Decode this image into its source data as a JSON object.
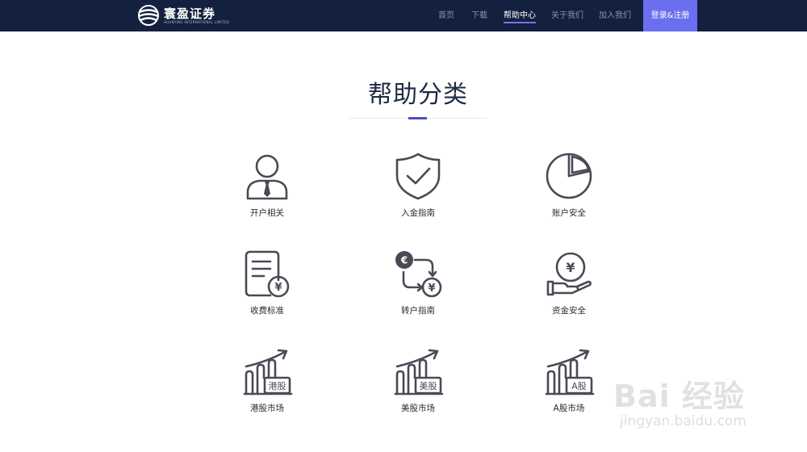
{
  "header": {
    "logo_text": "寰盈证券",
    "logo_subtext": "HUANYING INTERNATIONAL LIMITED",
    "nav": [
      {
        "label": "首页",
        "active": false
      },
      {
        "label": "下载",
        "active": false
      },
      {
        "label": "帮助中心",
        "active": true
      },
      {
        "label": "关于我们",
        "active": false
      },
      {
        "label": "加入我们",
        "active": false
      }
    ],
    "login_label": "登录&注册",
    "colors": {
      "bar": "#13203f",
      "accent": "#6a6ff0"
    }
  },
  "section": {
    "title": "帮助分类"
  },
  "categories": [
    {
      "label": "开户相关",
      "icon": "user-tie-icon"
    },
    {
      "label": "入金指南",
      "icon": "shield-check-icon"
    },
    {
      "label": "账户安全",
      "icon": "pie-chart-icon"
    },
    {
      "label": "收费标准",
      "icon": "document-yen-icon"
    },
    {
      "label": "转户指南",
      "icon": "currency-exchange-icon"
    },
    {
      "label": "资金安全",
      "icon": "hand-coin-icon"
    },
    {
      "label": "港股市场",
      "icon": "hk-stock-chart-icon",
      "badge": "港股"
    },
    {
      "label": "美股市场",
      "icon": "us-stock-chart-icon",
      "badge": "美股"
    },
    {
      "label": "A股市场",
      "icon": "a-stock-chart-icon",
      "badge": "A股"
    }
  ],
  "watermark": {
    "main": "Bai 经验",
    "sub": "jingyan.baidu.com"
  }
}
